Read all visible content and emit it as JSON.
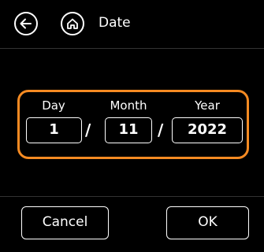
{
  "header": {
    "title": "Date",
    "back_icon": "back-arrow-icon",
    "home_icon": "home-icon"
  },
  "colors": {
    "accent": "#f58a22",
    "background": "#000000",
    "text": "#ffffff"
  },
  "date": {
    "labels": {
      "day": "Day",
      "month": "Month",
      "year": "Year"
    },
    "values": {
      "day": "1",
      "month": "11",
      "year": "2022"
    },
    "separator": "/"
  },
  "footer": {
    "cancel_label": "Cancel",
    "ok_label": "OK"
  }
}
